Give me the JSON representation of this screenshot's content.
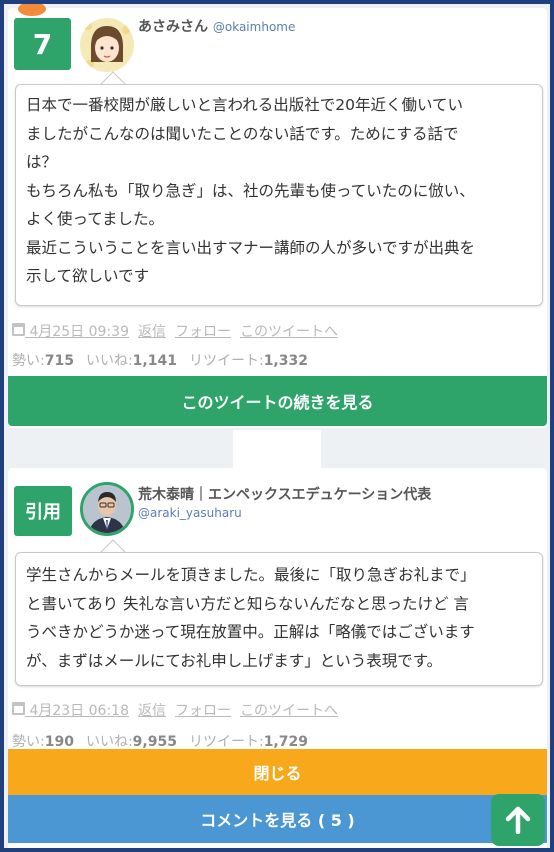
{
  "tweet1": {
    "rank": "7",
    "user_name": "あさみさん",
    "user_handle": "@okaimhome",
    "body_lines": [
      "日本で一番校閲が厳しいと言われる出版社で20年近く働いてい",
      "ましたがこんなのは聞いたことのない話です。ためにする話で",
      "は？",
      "もちろん私も「取り急ぎ」は、社の先輩も使っていたのに倣い、",
      "よく使ってました。",
      "最近こういうことを言い出すマナー講師の人が多いですが出典を",
      "示して欲しいです"
    ],
    "date": "4月25日 09:39",
    "reply": "返信",
    "follow": "フォロー",
    "to_tweet": "このツイートへ",
    "momentum_label": "勢い:",
    "momentum": "715",
    "likes_label": "いいね:",
    "likes": "1,141",
    "retweets_label": "リツイート:",
    "retweets": "1,332",
    "more_button": "このツイートの続きを見る"
  },
  "tweet2": {
    "badge": "引用",
    "user_name": "荒木泰晴｜エンペックスエデュケーション代表",
    "user_handle": "@araki_yasuharu",
    "body_lines": [
      "学生さんからメールを頂きました。最後に「取り急ぎお礼まで」",
      "と書いてあり 失礼な言い方だと知らないんだなと思ったけど 言",
      "うべきかどうか迷って現在放置中。正解は「略儀ではございます",
      "が、まずはメールにてお礼申し上げます」という表現です。"
    ],
    "date": "4月23日 06:18",
    "reply": "返信",
    "follow": "フォロー",
    "to_tweet": "このツイートへ",
    "momentum_label": "勢い:",
    "momentum": "190",
    "likes_label": "いいね:",
    "likes": "9,955",
    "retweets_label": "リツイート:",
    "retweets": "1,729"
  },
  "buttons": {
    "close": "閉じる",
    "comments": "コメントを見る ( 5 )"
  },
  "colors": {
    "accent_green": "#2ea36a",
    "orange": "#f7a81b",
    "blue": "#4a97d4",
    "frame": "#1f3f7f"
  },
  "icons": [
    "calendar-icon",
    "arrow-up-icon"
  ]
}
